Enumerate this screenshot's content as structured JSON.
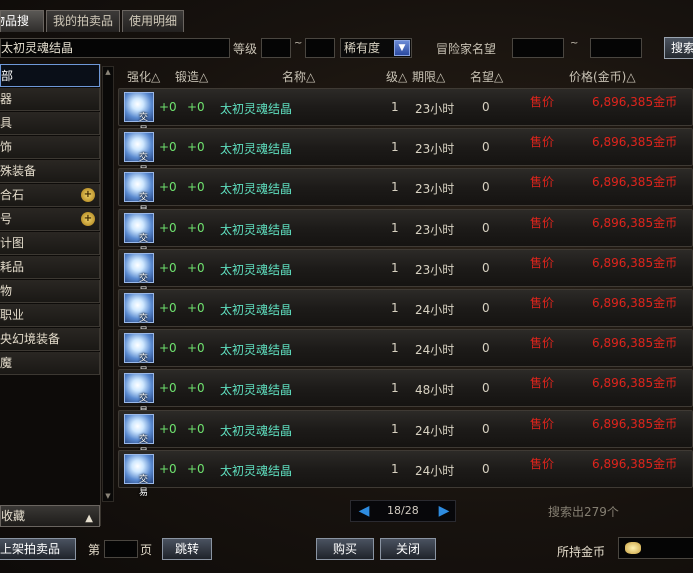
{
  "tabs": [
    {
      "label": "物品搜索",
      "active": true
    },
    {
      "label": "我的拍卖品",
      "active": false
    },
    {
      "label": "使用明细",
      "active": false
    }
  ],
  "search": {
    "item_name": "太初灵魂结晶",
    "level_label": "等级",
    "rarity_value": "稀有度",
    "adventurer_label": "冒险家名望",
    "tilde": "~",
    "search_button": "搜索"
  },
  "categories": [
    {
      "label": "全部",
      "active": true,
      "zoom": false
    },
    {
      "label": "武器",
      "active": false,
      "zoom": false
    },
    {
      "label": "防具",
      "active": false,
      "zoom": false
    },
    {
      "label": "首饰",
      "active": false,
      "zoom": false
    },
    {
      "label": "特殊装备",
      "active": false,
      "zoom": false
    },
    {
      "label": "融合石",
      "active": false,
      "zoom": true
    },
    {
      "label": "称号",
      "active": false,
      "zoom": true
    },
    {
      "label": "设计图",
      "active": false,
      "zoom": false
    },
    {
      "label": "消耗品",
      "active": false,
      "zoom": false
    },
    {
      "label": "宠物",
      "active": false,
      "zoom": false
    },
    {
      "label": "副职业",
      "active": false,
      "zoom": false
    },
    {
      "label": "未央幻境装备",
      "active": false,
      "zoom": false
    },
    {
      "label": "附魔",
      "active": false,
      "zoom": false
    }
  ],
  "collect_label": "收藏",
  "columns": {
    "enhance": "强化△",
    "forge": "锻造△",
    "name": "名称△",
    "level": "级△",
    "time_limit": "期限△",
    "fame": "名望△",
    "price": "价格(金币)△"
  },
  "rows": [
    {
      "icon_text": "交易",
      "enhance": "+0",
      "forge": "+0",
      "name": "太初灵魂结晶",
      "level": "1",
      "time": "23小时",
      "fame": "0",
      "sale": "售价",
      "price": "6,896,385金币"
    },
    {
      "icon_text": "交易",
      "enhance": "+0",
      "forge": "+0",
      "name": "太初灵魂结晶",
      "level": "1",
      "time": "23小时",
      "fame": "0",
      "sale": "售价",
      "price": "6,896,385金币"
    },
    {
      "icon_text": "交易",
      "enhance": "+0",
      "forge": "+0",
      "name": "太初灵魂结晶",
      "level": "1",
      "time": "23小时",
      "fame": "0",
      "sale": "售价",
      "price": "6,896,385金币"
    },
    {
      "icon_text": "交易",
      "enhance": "+0",
      "forge": "+0",
      "name": "太初灵魂结晶",
      "level": "1",
      "time": "23小时",
      "fame": "0",
      "sale": "售价",
      "price": "6,896,385金币"
    },
    {
      "icon_text": "交易",
      "enhance": "+0",
      "forge": "+0",
      "name": "太初灵魂结晶",
      "level": "1",
      "time": "23小时",
      "fame": "0",
      "sale": "售价",
      "price": "6,896,385金币"
    },
    {
      "icon_text": "交易",
      "enhance": "+0",
      "forge": "+0",
      "name": "太初灵魂结晶",
      "level": "1",
      "time": "24小时",
      "fame": "0",
      "sale": "售价",
      "price": "6,896,385金币"
    },
    {
      "icon_text": "交易",
      "enhance": "+0",
      "forge": "+0",
      "name": "太初灵魂结晶",
      "level": "1",
      "time": "24小时",
      "fame": "0",
      "sale": "售价",
      "price": "6,896,385金币"
    },
    {
      "icon_text": "交易",
      "enhance": "+0",
      "forge": "+0",
      "name": "太初灵魂结晶",
      "level": "1",
      "time": "48小时",
      "fame": "0",
      "sale": "售价",
      "price": "6,896,385金币"
    },
    {
      "icon_text": "交易",
      "enhance": "+0",
      "forge": "+0",
      "name": "太初灵魂结晶",
      "level": "1",
      "time": "24小时",
      "fame": "0",
      "sale": "售价",
      "price": "6,896,385金币"
    },
    {
      "icon_text": "交易",
      "enhance": "+0",
      "forge": "+0",
      "name": "太初灵魂结晶",
      "level": "1",
      "time": "24小时",
      "fame": "0",
      "sale": "售价",
      "price": "6,896,385金币"
    }
  ],
  "pager": {
    "text": "18/28",
    "prev": "◀",
    "next": "▶"
  },
  "found_text": "搜索出279个",
  "bottom": {
    "list_button": "上架拍卖品",
    "page_prefix": "第",
    "page_suffix": "页",
    "jump_button": "跳转",
    "buy_button": "购买",
    "close_button": "关闭",
    "gold_label": "所持金币"
  }
}
